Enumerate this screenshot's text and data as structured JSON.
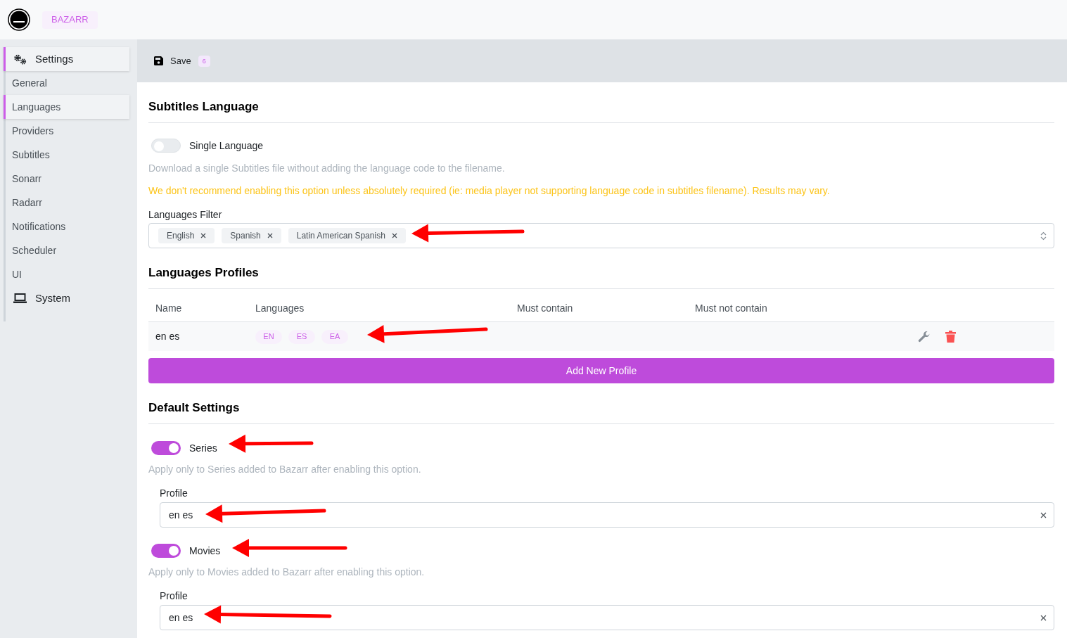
{
  "app": {
    "name": "BAZARR"
  },
  "sidebar": {
    "items": [
      {
        "label": "Settings",
        "kind": "section",
        "selected": true
      },
      {
        "label": "General",
        "kind": "link",
        "selected": false
      },
      {
        "label": "Languages",
        "kind": "link",
        "selected": true
      },
      {
        "label": "Providers",
        "kind": "link",
        "selected": false
      },
      {
        "label": "Subtitles",
        "kind": "link",
        "selected": false
      },
      {
        "label": "Sonarr",
        "kind": "link",
        "selected": false
      },
      {
        "label": "Radarr",
        "kind": "link",
        "selected": false
      },
      {
        "label": "Notifications",
        "kind": "link",
        "selected": false
      },
      {
        "label": "Scheduler",
        "kind": "link",
        "selected": false
      },
      {
        "label": "UI",
        "kind": "link",
        "selected": false
      },
      {
        "label": "System",
        "kind": "section",
        "selected": false
      }
    ]
  },
  "toolbar": {
    "save_label": "Save",
    "badge": "6"
  },
  "subtitles_language": {
    "title": "Subtitles Language",
    "single_language": {
      "label": "Single Language",
      "on": false,
      "description": "Download a single Subtitles file without adding the language code to the filename.",
      "warning": "We don't recommend enabling this option unless absolutely required (ie: media player not supporting language code in subtitles filename). Results may vary."
    },
    "filter": {
      "label": "Languages Filter",
      "tags": [
        "English",
        "Spanish",
        "Latin American Spanish"
      ]
    }
  },
  "profiles": {
    "title": "Languages Profiles",
    "columns": [
      "Name",
      "Languages",
      "Must contain",
      "Must not contain"
    ],
    "rows": [
      {
        "name": "en es",
        "languages": [
          "EN",
          "ES",
          "EA"
        ]
      }
    ],
    "add_button": "Add New Profile"
  },
  "defaults": {
    "title": "Default Settings",
    "items": [
      {
        "label": "Series",
        "on": true,
        "description": "Apply only to Series added to Bazarr after enabling this option.",
        "profile_label": "Profile",
        "profile_value": "en es"
      },
      {
        "label": "Movies",
        "on": true,
        "description": "Apply only to Movies added to Bazarr after enabling this option.",
        "profile_label": "Profile",
        "profile_value": "en es"
      }
    ]
  }
}
